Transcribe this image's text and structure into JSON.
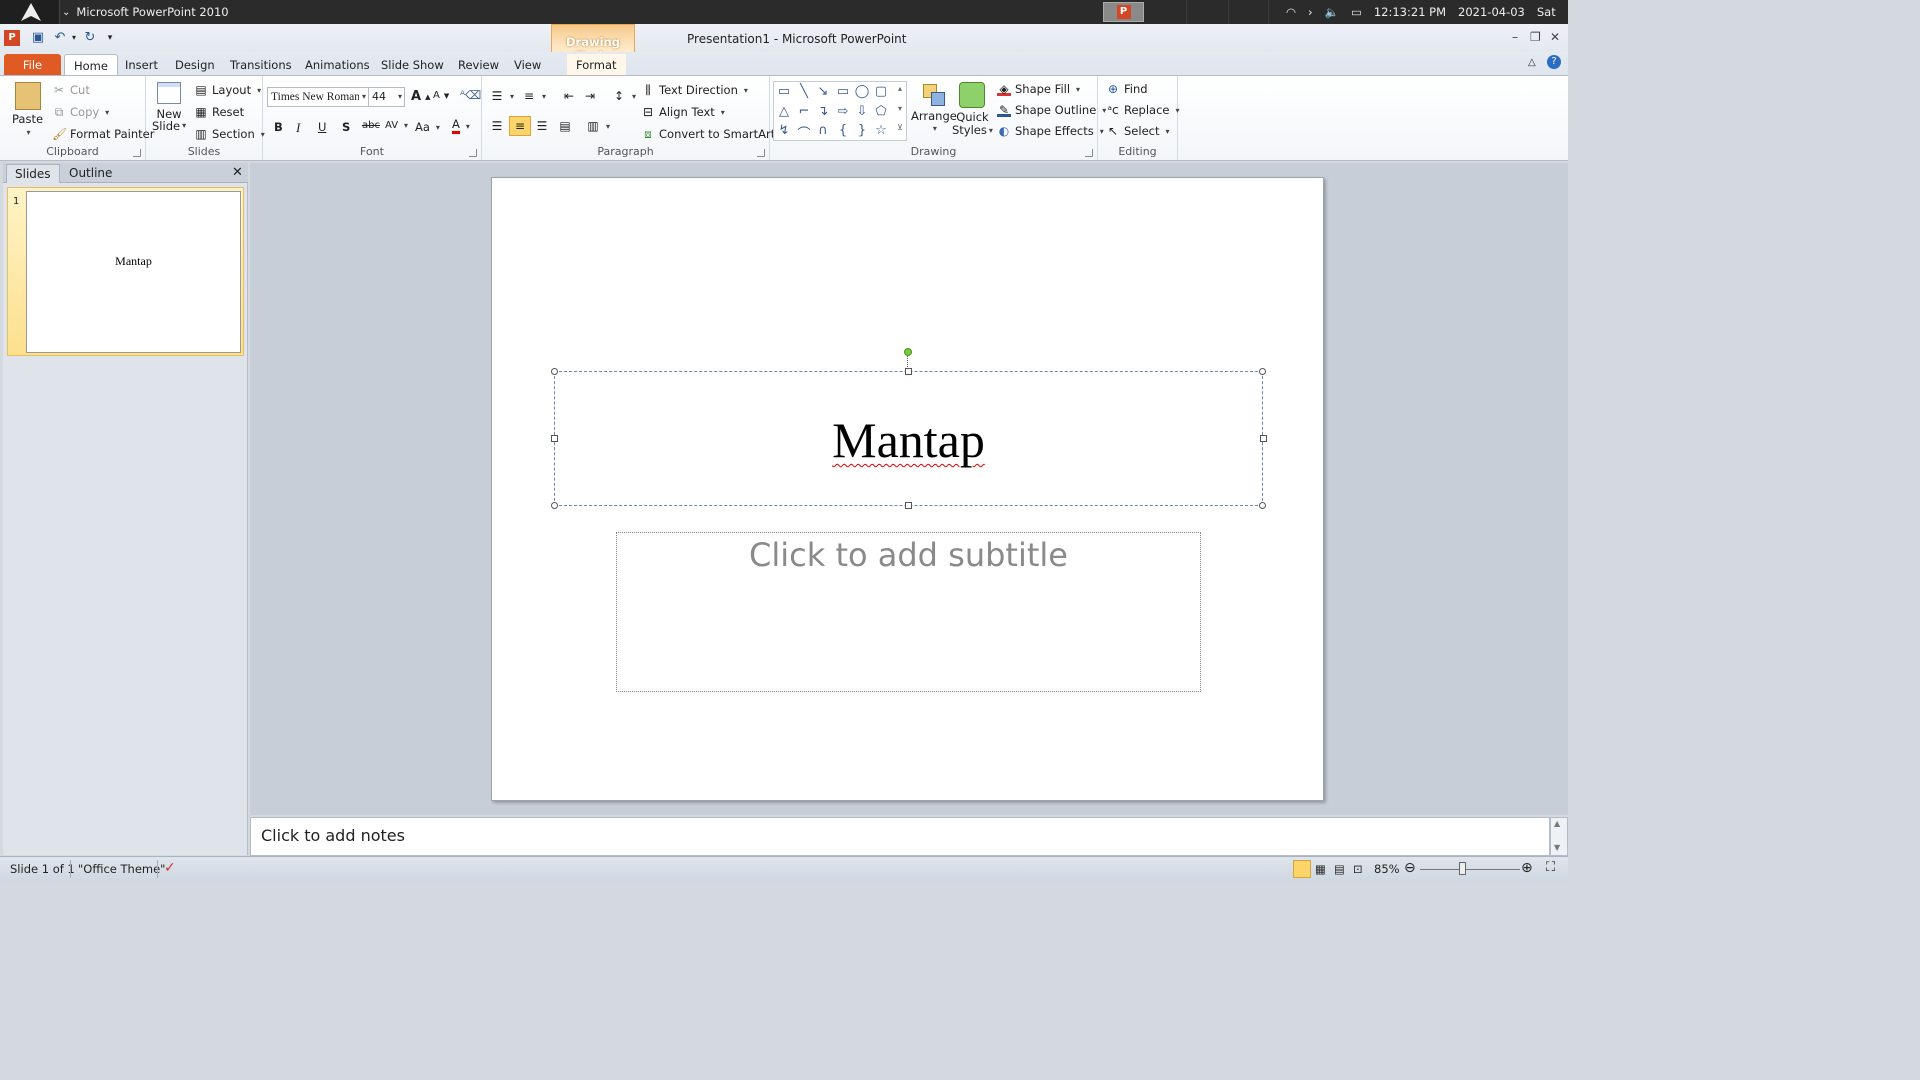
{
  "os_bar": {
    "app_title": "Microsoft PowerPoint 2010",
    "time": "12:13:21 PM",
    "date": "2021-04-03",
    "day": "Sat",
    "taskbar_icon": "P"
  },
  "window": {
    "title": "Presentation1 - Microsoft PowerPoint",
    "context_tab_group": "Drawing Tools",
    "app_icon": "P"
  },
  "tabs": [
    "File",
    "Home",
    "Insert",
    "Design",
    "Transitions",
    "Animations",
    "Slide Show",
    "Review",
    "View",
    "Format"
  ],
  "ribbon": {
    "clipboard": {
      "paste": "Paste",
      "cut": "Cut",
      "copy": "Copy",
      "format_painter": "Format Painter",
      "label": "Clipboard"
    },
    "slides": {
      "new_slide_1": "New",
      "new_slide_2": "Slide",
      "layout": "Layout",
      "reset": "Reset",
      "section": "Section",
      "label": "Slides"
    },
    "font": {
      "name": "Times New Roman",
      "size": "44",
      "bold": "B",
      "italic": "I",
      "underline": "U",
      "shadow": "S",
      "strike": "abc",
      "spacing": "AV",
      "case": "Aa",
      "color": "A",
      "grow": "A",
      "shrink": "A",
      "label": "Font"
    },
    "paragraph": {
      "text_direction": "Text Direction",
      "align_text": "Align Text",
      "convert": "Convert to SmartArt",
      "label": "Paragraph"
    },
    "drawing": {
      "arrange": "Arrange",
      "quick_1": "Quick",
      "quick_2": "Styles",
      "shape_fill": "Shape Fill",
      "shape_outline": "Shape Outline",
      "shape_effects": "Shape Effects",
      "label": "Drawing"
    },
    "editing": {
      "find": "Find",
      "replace": "Replace",
      "select": "Select",
      "label": "Editing"
    }
  },
  "left_pane": {
    "tab_slides": "Slides",
    "tab_outline": "Outline",
    "slide_number": "1",
    "thumb_title": "Mantap"
  },
  "slide": {
    "title": "Mantap",
    "subtitle_placeholder": "Click to add subtitle"
  },
  "notes": {
    "placeholder": "Click to add notes"
  },
  "status": {
    "slide_info": "Slide 1 of 1",
    "theme": "\"Office Theme\"",
    "zoom": "85%"
  },
  "colors": {
    "file_tab": "#e05a24",
    "context_tab": "#f7c98a",
    "selection": "#6b86ae",
    "rotation_handle": "#7ccb3c"
  }
}
